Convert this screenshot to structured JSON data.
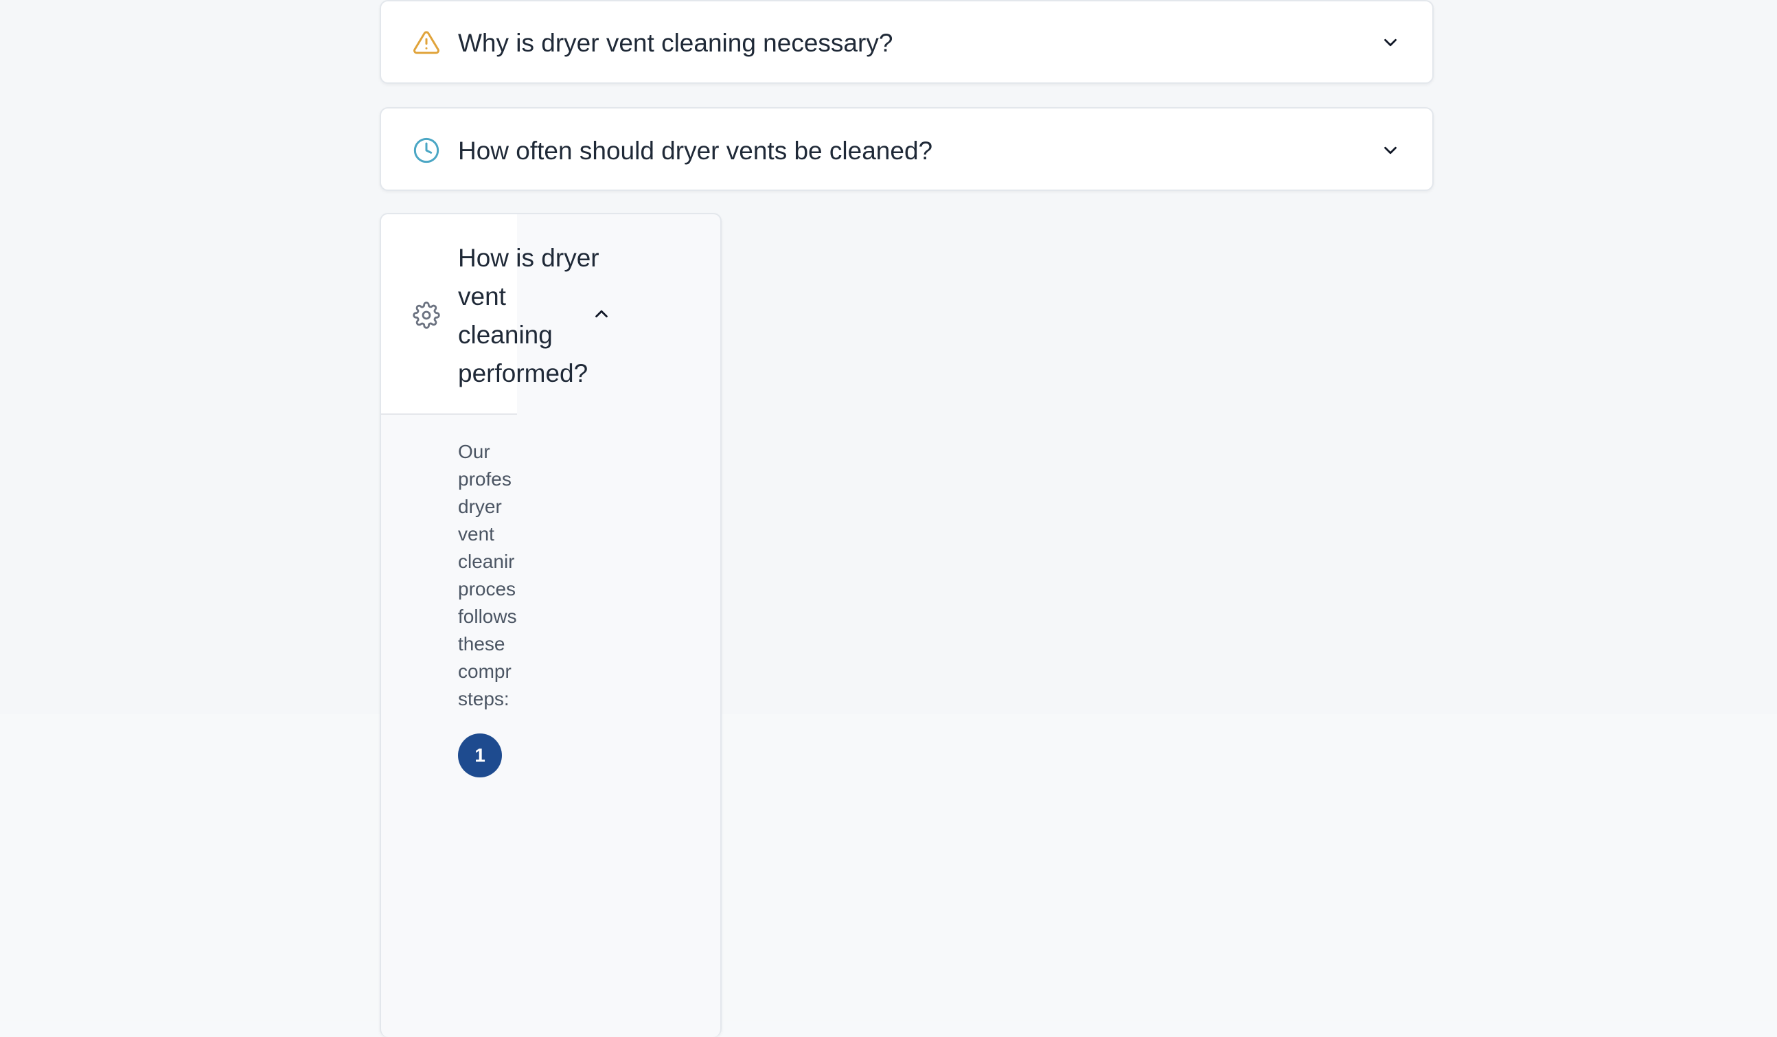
{
  "colors": {
    "warning_icon": "#e0a33a",
    "clock_icon": "#4aa6c4",
    "gear_icon": "#6b7280",
    "step_badge": "#1e4b8f"
  },
  "faq": {
    "items": [
      {
        "icon": "warning-icon",
        "question": "Why is dryer vent cleaning necessary?",
        "expanded": false
      },
      {
        "icon": "clock-icon",
        "question": "How often should dryer vents be cleaned?",
        "expanded": false
      },
      {
        "icon": "gear-icon",
        "question": "How is dryer vent cleaning performed?",
        "expanded": true,
        "answer_lines": [
          "Our",
          "profes",
          "dryer",
          "vent",
          "cleanir",
          "proces",
          "follows",
          "these",
          "compr",
          "steps:"
        ],
        "steps": [
          {
            "number": "1"
          }
        ]
      }
    ]
  }
}
